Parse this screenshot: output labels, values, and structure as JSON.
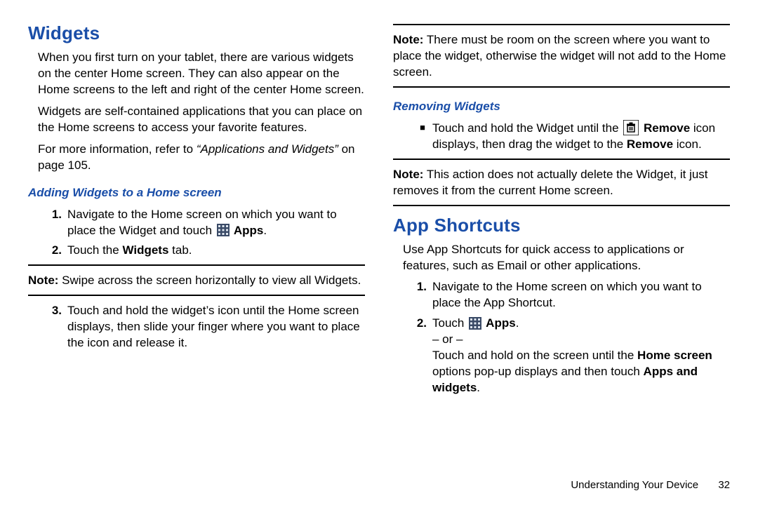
{
  "left": {
    "h1": "Widgets",
    "p1": "When you first turn on your tablet, there are various widgets on the center Home screen. They can also appear on the Home screens to the left and right of the center Home screen.",
    "p2": "Widgets are self-contained applications that you can place on the Home screens to access your favorite features.",
    "p3a": "For more information, refer to ",
    "p3q": "“Applications and Widgets”",
    "p3b": " on page 105.",
    "h2": "Adding Widgets to a Home screen",
    "s1n": "1.",
    "s1a": "Navigate to the Home screen on which you want to place the Widget and touch ",
    "s1b": " Apps",
    "s1c": ".",
    "s2n": "2.",
    "s2a": "Touch the ",
    "s2b": "Widgets",
    "s2c": " tab.",
    "note1a": "Note:",
    "note1b": " Swipe across the screen horizontally to view all Widgets.",
    "s3n": "3.",
    "s3": "Touch and hold the widget’s icon until the Home screen displays, then slide your finger where you want to place the icon and release it."
  },
  "right": {
    "note2a": "Note:",
    "note2b": " There must be room on the screen where you want to place the widget, otherwise the widget will not add to the Home screen.",
    "h2rem": "Removing Widgets",
    "b1a": "Touch and hold the Widget until the ",
    "b1b": " Remove",
    "b1c": " icon displays, then drag the widget to the ",
    "b1d": "Remove",
    "b1e": " icon.",
    "note3a": "Note:",
    "note3b": " This action does not actually delete the Widget, it just removes it from the current Home screen.",
    "h1app": "App Shortcuts",
    "p1": "Use App Shortcuts for quick access to applications or features, such as Email or other applications.",
    "s1n": "1.",
    "s1": "Navigate to the Home screen on which you want to place the App Shortcut.",
    "s2n": "2.",
    "s2a": "Touch ",
    "s2b": " Apps",
    "s2c": ".",
    "s2or": "– or –",
    "s2d": "Touch and hold on the screen until the ",
    "s2e": "Home screen",
    "s2f": " options pop-up displays and then touch ",
    "s2g": "Apps and widgets",
    "s2h": "."
  },
  "footer": {
    "section": "Understanding Your Device",
    "page": "32"
  }
}
